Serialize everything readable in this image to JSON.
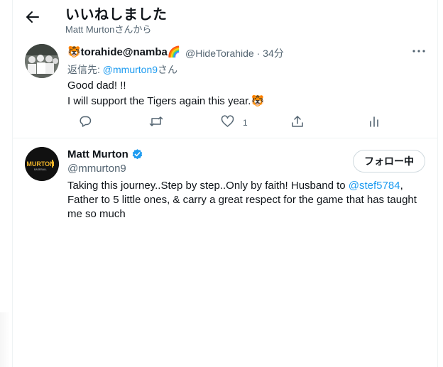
{
  "header": {
    "title": "いいねしました",
    "subtitle": "Matt Murtonさんから"
  },
  "tweet": {
    "author_name": "🐯torahide@namba🌈",
    "author_handle": "@HideTorahide",
    "separator": "·",
    "time": "34分",
    "reply_prefix": "返信先: ",
    "reply_to": "@mmurton9",
    "reply_suffix": "さん",
    "text_line1": "Good dad! !!",
    "text_line2": "I will support the Tigers again this year.🐯",
    "like_count": "1"
  },
  "profile": {
    "name": "Matt Murton",
    "handle": "@mmurton9",
    "follow_label": "フォロー中",
    "avatar_text": "MURTON",
    "avatar_subtext": "BASEBALL",
    "bio_part1": "Taking this journey..Step by step..Only by faith! Husband to ",
    "bio_mention": "@stef5784",
    "bio_part2": ", Father to 5 little ones, & carry a great respect for the game that has taught me so much"
  },
  "colors": {
    "accent": "#1d9bf0",
    "muted": "#536471",
    "text": "#0f1419",
    "border": "#eff3f4"
  }
}
